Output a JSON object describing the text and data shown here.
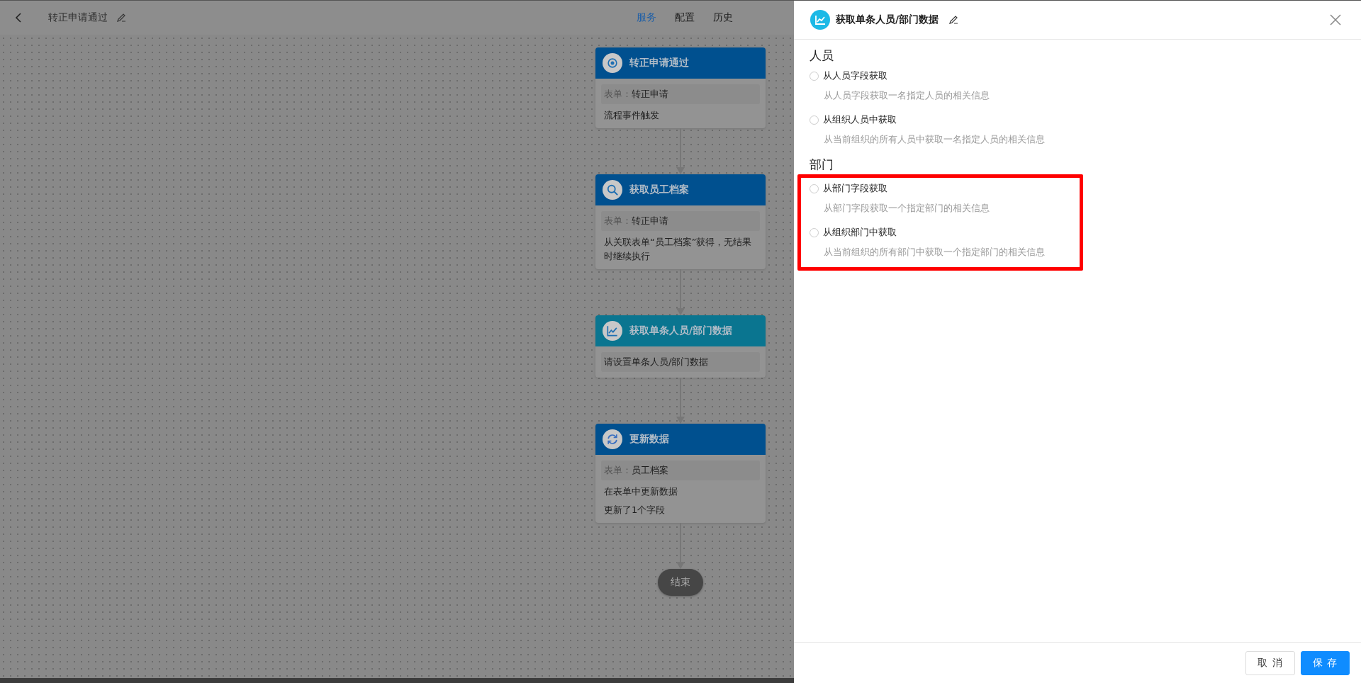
{
  "topbar": {
    "title": "转正申请通过",
    "tabs": [
      {
        "label": "服务",
        "selected": true
      },
      {
        "label": "配置",
        "selected": false
      },
      {
        "label": "历史",
        "selected": false
      }
    ]
  },
  "flow": {
    "nodes": [
      {
        "title": "转正申请通过",
        "kind": "target",
        "color": "#00508f",
        "rows": [
          {
            "kind": "field",
            "label": "表单：",
            "value": "转正申请"
          },
          {
            "kind": "text",
            "text": "流程事件触发"
          }
        ]
      },
      {
        "title": "获取员工档案",
        "kind": "search",
        "color": "#00508f",
        "rows": [
          {
            "kind": "field",
            "label": "表单：",
            "value": "转正申请"
          },
          {
            "kind": "text",
            "text": "从关联表单“员工档案”获得，无结果时继续执行"
          }
        ]
      },
      {
        "title": "获取单条人员/部门数据",
        "kind": "chart",
        "color": "#0a7590",
        "rows": [
          {
            "kind": "field",
            "value": "请设置单条人员/部门数据"
          }
        ]
      },
      {
        "title": "更新数据",
        "kind": "sync",
        "color": "#00508f",
        "rows": [
          {
            "kind": "field",
            "label": "表单：",
            "value": "员工档案"
          },
          {
            "kind": "text",
            "text": "在表单中更新数据"
          },
          {
            "kind": "text",
            "text": "更新了1个字段"
          }
        ]
      }
    ],
    "end": "结束"
  },
  "drawer": {
    "title": "获取单条人员/部门数据",
    "sections": [
      {
        "title": "人员",
        "highlighted": false,
        "options": [
          {
            "label": "从人员字段获取",
            "description": "从人员字段获取一名指定人员的相关信息",
            "selected": false
          },
          {
            "label": "从组织人员中获取",
            "description": "从当前组织的所有人员中获取一名指定人员的相关信息",
            "selected": false
          }
        ]
      },
      {
        "title": "部门",
        "highlighted": true,
        "options": [
          {
            "label": "从部门字段获取",
            "description": "从部门字段获取一个指定部门的相关信息",
            "selected": false
          },
          {
            "label": "从组织部门中获取",
            "description": "从当前组织的所有部门中获取一个指定部门的相关信息",
            "selected": false
          }
        ]
      }
    ],
    "buttons": [
      "取 消",
      "保 存"
    ]
  }
}
